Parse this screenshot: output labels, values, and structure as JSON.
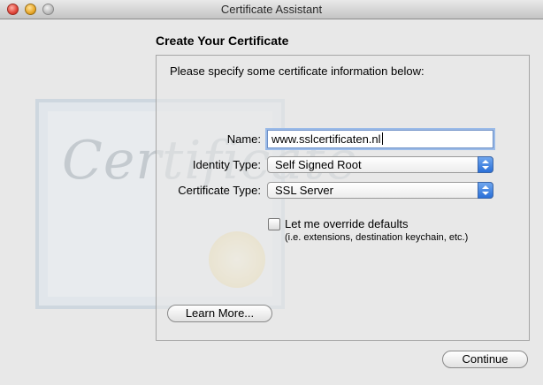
{
  "window": {
    "title": "Certificate Assistant"
  },
  "heading": "Create Your Certificate",
  "intro": "Please specify some certificate information below:",
  "form": {
    "name_label": "Name:",
    "name_value": "www.sslcertificaten.nl",
    "identity_type_label": "Identity Type:",
    "identity_type_value": "Self Signed Root",
    "certificate_type_label": "Certificate Type:",
    "certificate_type_value": "SSL Server",
    "override_label": "Let me override defaults",
    "override_hint": "(i.e. extensions, destination keychain, etc.)",
    "override_checked": false
  },
  "buttons": {
    "learn_more": "Learn More...",
    "continue": "Continue"
  },
  "icons": [
    "close-button",
    "minimize-button",
    "zoom-button",
    "popup-arrows-icon",
    "certificate-illustration"
  ]
}
